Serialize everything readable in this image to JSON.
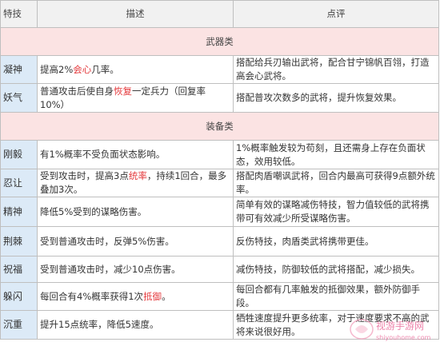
{
  "header": {
    "col_skill": "特技",
    "col_desc": "描述",
    "col_comment": "点评"
  },
  "sections": [
    {
      "title": "武器类",
      "rows": [
        {
          "name": "凝神",
          "desc": [
            {
              "t": "提高2%"
            },
            {
              "t": "会心",
              "hl": true
            },
            {
              "t": "几率。"
            }
          ],
          "comment": "搭配给兵刃输出武将，配合甘宁锦帆百翎，打造高会心武将。"
        },
        {
          "name": "妖气",
          "desc": [
            {
              "t": "普通攻击后使自身"
            },
            {
              "t": "恢复",
              "hl": true
            },
            {
              "t": "一定兵力（回复率10%）"
            }
          ],
          "comment": "搭配普攻次数多的武将，提升恢复效果。"
        }
      ]
    },
    {
      "title": "装备类",
      "rows": [
        {
          "name": "刚毅",
          "desc": [
            {
              "t": "有1%概率不受负面状态影响。"
            }
          ],
          "comment": "1%概率触发较为苟刻，且还需身上存在负面状态，效用较低。"
        },
        {
          "name": "忍让",
          "desc": [
            {
              "t": "受到攻击时，提高3点"
            },
            {
              "t": "统率",
              "hl": true
            },
            {
              "t": "，持续1回合，最多叠加3次。"
            }
          ],
          "comment": "搭配肉盾嘲讽武将，回合内最高可获得9点额外统率。"
        },
        {
          "name": "精神",
          "desc": [
            {
              "t": "降低5%受到的谋略伤害。"
            }
          ],
          "comment": "简单有效的谋略减伤特技，智力值较低的武将携带可有效减少所受谋略伤害。"
        },
        {
          "name": "荆棘",
          "desc": [
            {
              "t": "受到普通攻击时，反弹5%伤害。"
            }
          ],
          "comment": "反伤特技，肉盾类武将携带更佳。"
        },
        {
          "name": "祝福",
          "desc": [
            {
              "t": "受到普通攻击时，减少10点伤害。"
            }
          ],
          "comment": "减伤特技，防御较低的武将搭配，减少损失。"
        },
        {
          "name": "躲闪",
          "desc": [
            {
              "t": "每回合有4%概率获得1次"
            },
            {
              "t": "抵御",
              "hl": true
            },
            {
              "t": "。"
            }
          ],
          "comment": "每回合都有几率触发的抵御效果，额外防御手段。"
        },
        {
          "name": "沉重",
          "desc": [
            {
              "t": "提升15点统率，降低5速度。"
            }
          ],
          "comment": "牺牲速度提升更多统率，对于速度要求不高的武将来说很好用。"
        }
      ]
    }
  ],
  "watermark": {
    "name": "视游手游网",
    "url": "shiyouhome.com"
  },
  "colors": {
    "highlight": "#e4393c",
    "name_cell_bg": "#dceaf7",
    "section_bg": "#fbe3e3",
    "header_bg": "#f1f1f1"
  }
}
